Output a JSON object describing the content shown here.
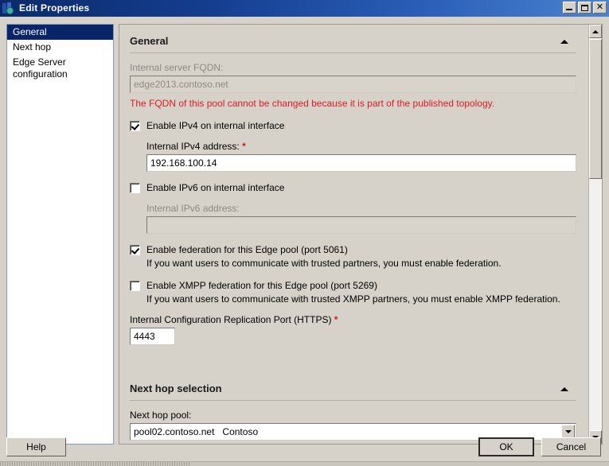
{
  "window": {
    "title": "Edit Properties",
    "icon": "lync-topology-icon",
    "controls": {
      "minimize": "minimize-button",
      "maximize": "maximize-button",
      "close_label": "✕"
    }
  },
  "sidebar": {
    "items": [
      {
        "label": "General",
        "selected": true
      },
      {
        "label": "Next hop",
        "selected": false
      },
      {
        "label": "Edge Server\nconfiguration",
        "selected": false
      }
    ]
  },
  "sections": {
    "general": {
      "title": "General",
      "collapse_icon": "triangle-up-icon",
      "fqdn": {
        "label": "Internal server FQDN:",
        "value": "edge2013.contoso.net",
        "disabled": true
      },
      "fqdn_warning": "The FQDN of this pool cannot be changed because it is part of the published topology.",
      "enable_ipv4": {
        "label": "Enable IPv4 on internal interface",
        "checked": true
      },
      "ipv4_address": {
        "label": "Internal IPv4 address:",
        "required_marker": "*",
        "value": "192.168.100.14"
      },
      "enable_ipv6": {
        "label": "Enable IPv6 on internal interface",
        "checked": false
      },
      "ipv6_address": {
        "label": "Internal IPv6 address:",
        "value": "",
        "disabled": true
      },
      "enable_federation": {
        "label": "Enable federation for this Edge pool (port 5061)",
        "checked": true,
        "description": "If you want users to communicate with trusted partners, you must enable federation."
      },
      "enable_xmpp_federation": {
        "label": "Enable XMPP federation for this Edge pool (port 5269)",
        "checked": false,
        "description": "If you want users to communicate with trusted XMPP partners, you must enable XMPP federation."
      },
      "replication_port": {
        "label": "Internal Configuration Replication Port (HTTPS)",
        "required_marker": "*",
        "value": "4443"
      }
    },
    "next_hop": {
      "title": "Next hop selection",
      "collapse_icon": "triangle-up-icon",
      "pool": {
        "label": "Next hop pool:",
        "value": "pool02.contoso.net   Contoso",
        "dropdown_icon": "chevron-down-icon"
      }
    }
  },
  "scrollbar": {
    "up_icon": "triangle-up-icon",
    "down_icon": "triangle-down-icon"
  },
  "footer": {
    "help_label": "Help",
    "ok_label": "OK",
    "cancel_label": "Cancel"
  },
  "colors": {
    "titlebar_start": "#0b2a6b",
    "titlebar_end": "#4b83cf",
    "selection": "#0a246a",
    "error_text": "#e01b24",
    "required_marker": "#d21a1a",
    "dialog_bg": "#d6d2ca"
  }
}
